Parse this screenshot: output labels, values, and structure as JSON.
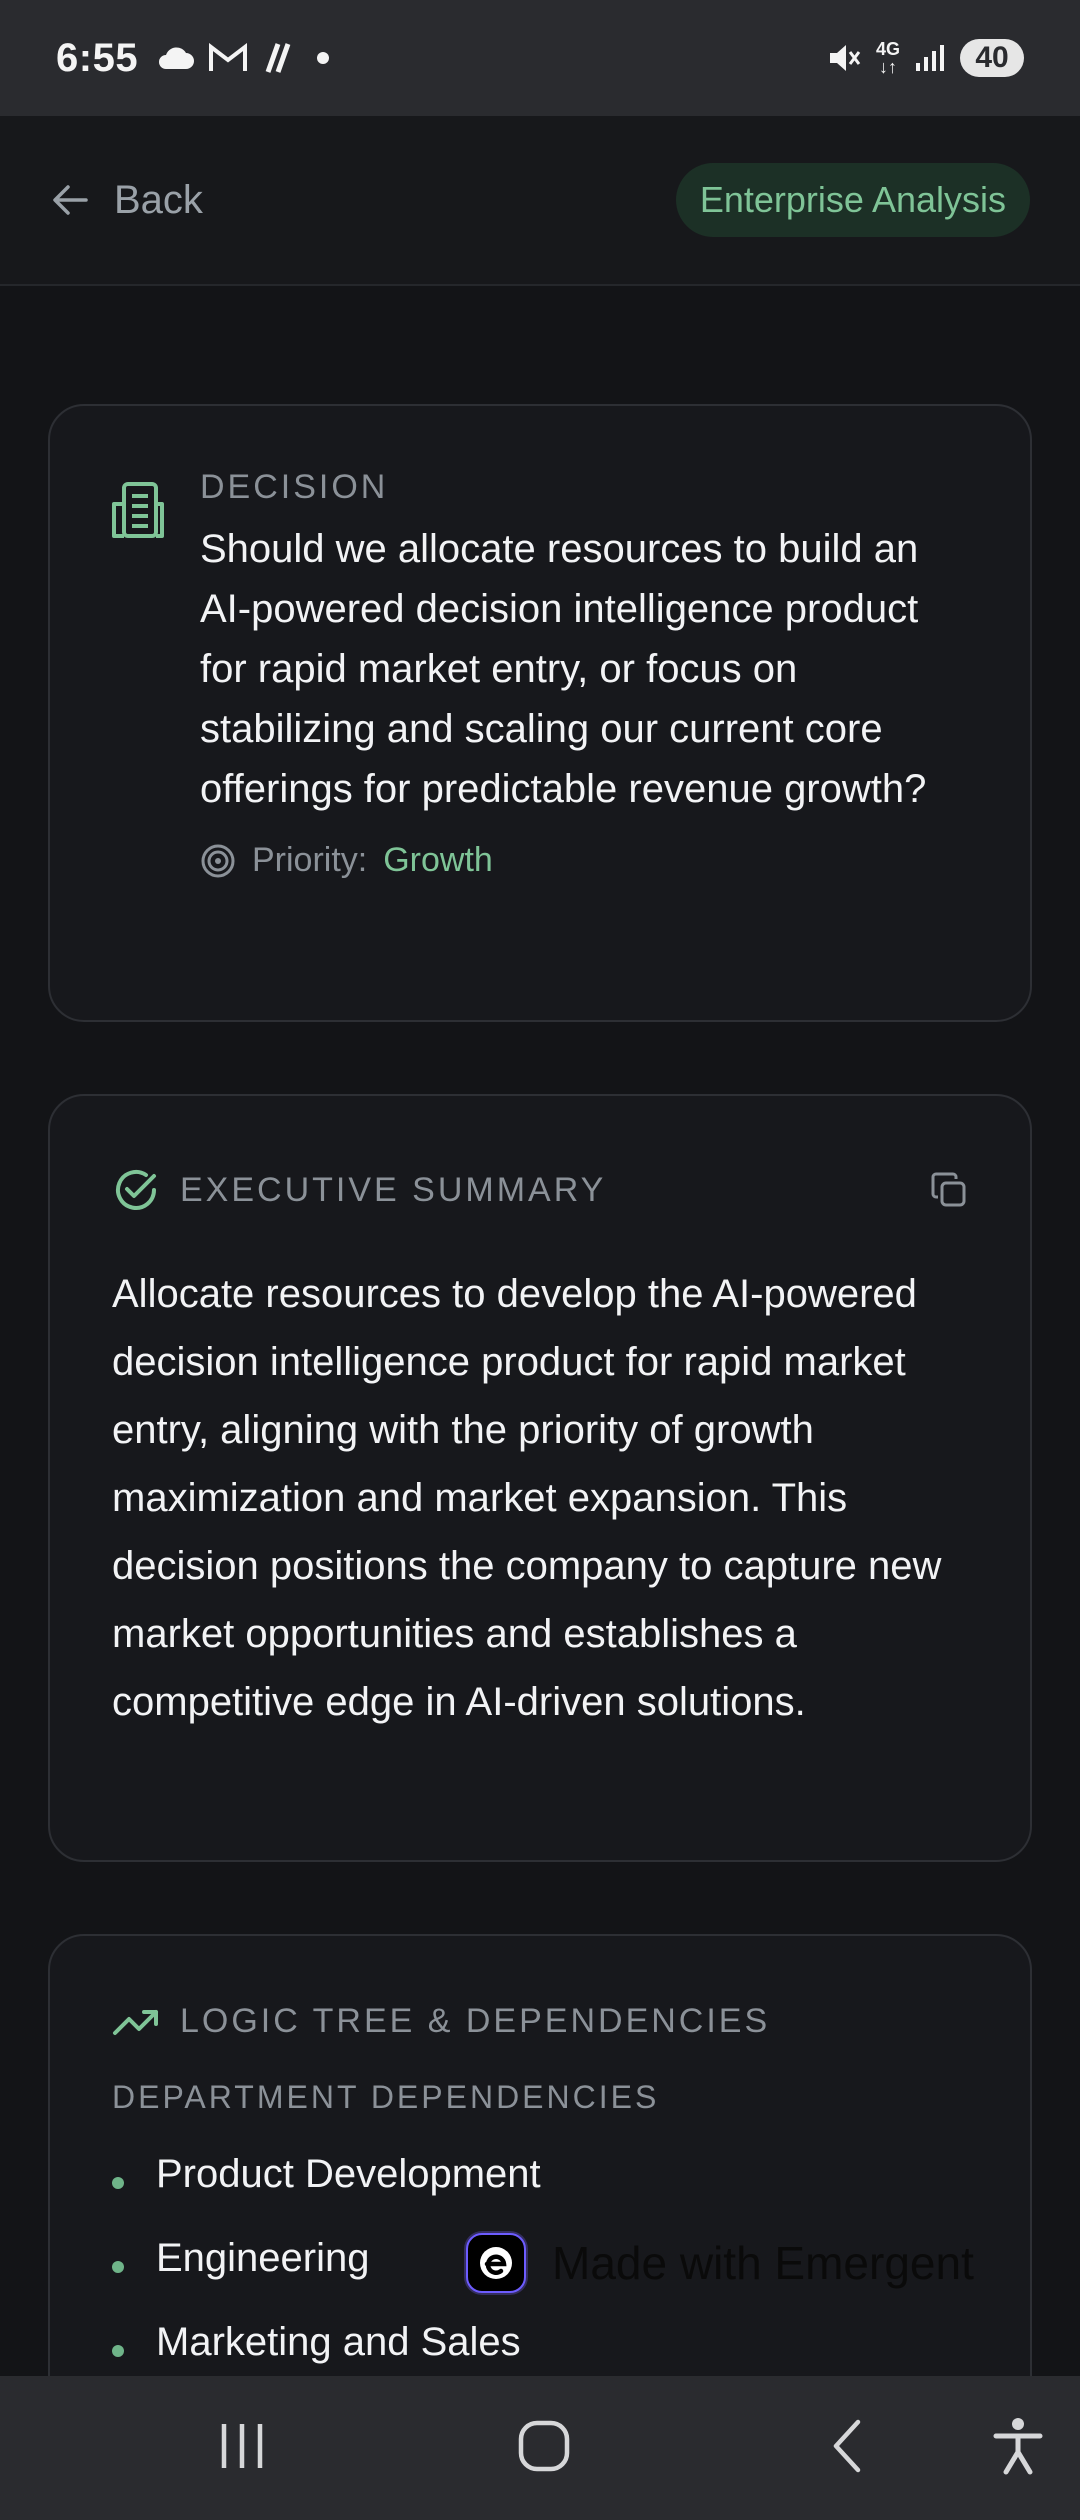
{
  "status_bar": {
    "time": "6:55",
    "network_label_top": "4G",
    "network_label_bottom": "↓↑",
    "battery": "40"
  },
  "nav": {
    "back_label": "Back",
    "tag": "Enterprise Analysis"
  },
  "decision": {
    "eyebrow": "DECISION",
    "question": "Should we allocate resources to build an AI-powered decision intelligence product for rapid market entry, or focus on stabilizing and scaling our current core offerings for predictable revenue growth?",
    "priority_label": "Priority:",
    "priority_value": "Growth"
  },
  "summary": {
    "eyebrow": "EXECUTIVE SUMMARY",
    "text": "Allocate resources to develop the AI-powered decision intelligence product for rapid market entry, aligning with the priority of growth maximization and market expansion. This decision positions the company to capture new market opportunities and establishes a competitive edge in AI-driven solutions."
  },
  "logic": {
    "eyebrow": "LOGIC TREE & DEPENDENCIES",
    "sub_eyebrow": "DEPARTMENT DEPENDENCIES",
    "departments": [
      "Product Development",
      "Engineering",
      "Marketing and Sales"
    ]
  },
  "badge": {
    "text": "Made with Emergent"
  },
  "colors": {
    "accent_green": "#7fc497",
    "background": "#131417",
    "card": "#17181c"
  }
}
